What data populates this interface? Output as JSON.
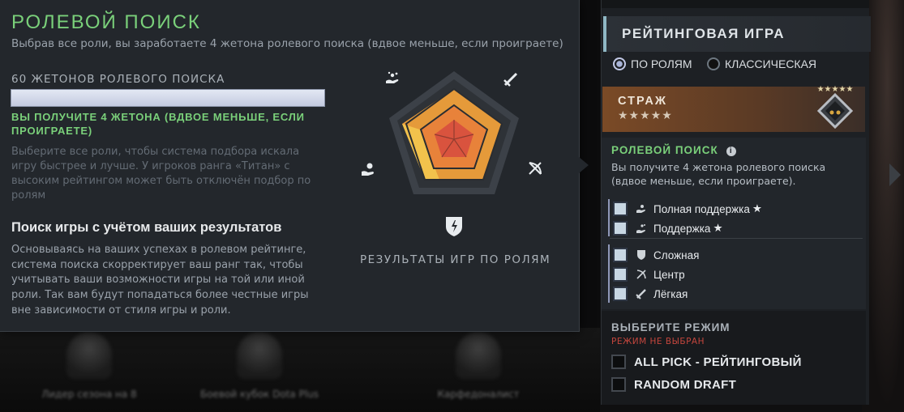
{
  "tooltip": {
    "title": "РОЛЕВОЙ ПОИСК",
    "subtitle": "Выбрав все роли, вы заработаете 4 жетона ролевого поиска (вдвое меньше, если проиграете)",
    "tokens_label": "60 ЖЕТОНОВ РОЛЕВОГО ПОИСКА",
    "token_bar_fill": 1.0,
    "reward_line1": "ВЫ ПОЛУЧИТЕ 4 ЖЕТОНА (ВДВОЕ МЕНЬШЕ, ЕСЛИ",
    "reward_line2": "ПРОИГРАЕТЕ)",
    "hint_line1": "Выберите все роли, чтобы система подбора искала",
    "hint_line2": "игру быстрее и лучше. У игроков ранга «Титан» с",
    "hint_line3": "высоким рейтингом может быть отключён подбор по",
    "hint_line4": "ролям",
    "section_title": "Поиск игры с учётом ваших результатов",
    "section_line1": "Основываясь на ваших успехах в ролевом рейтинге,",
    "section_line2": "система поиска скорректирует ваш ранг так, чтобы",
    "section_line3": "учитывать ваши возможности игры на той или иной",
    "section_line4": "роли. Так вам будут попадаться более честные игры",
    "section_line5": "вне зависимости от стиля игры и роли.",
    "radar_caption": "РЕЗУЛЬТАТЫ ИГР ПО РОЛЯМ",
    "radar_icons": [
      "support-hands-icon",
      "sword-icon",
      "bow-icon",
      "offlane-shield-icon",
      "hard-support-hand-icon"
    ]
  },
  "panel": {
    "title": "РЕЙТИНГОВАЯ ИГРА",
    "radio_roles": "ПО РОЛЯМ",
    "radio_classic": "КЛАССИЧЕСКАЯ",
    "rank_name": "СТРАЖ",
    "rank_stars": "★★★★★",
    "medal_stars": "★★★★★",
    "role_title": "РОЛЕВОЙ ПОИСК",
    "role_desc_line1": "Вы получите 4 жетона ролевого поиска",
    "role_desc_line2": "(вдвое меньше, если проиграете).",
    "roles": [
      {
        "label": "Полная поддержка",
        "star": "★"
      },
      {
        "label": "Поддержка",
        "star": "★"
      },
      {
        "label": "Сложная",
        "star": ""
      },
      {
        "label": "Центр",
        "star": ""
      },
      {
        "label": "Лёгкая",
        "star": ""
      }
    ],
    "mode_title": "ВЫБЕРИТЕ РЕЖИМ",
    "mode_warning": "РЕЖИМ НЕ ВЫБРАН",
    "modes": [
      "ALL PICK - РЕЙТИНГОВЫЙ",
      "RANDOM DRAFT"
    ]
  },
  "colors": {
    "accent_green": "#7ad07a",
    "warning_red": "#c4463d",
    "panel_bg": "#23272c"
  },
  "background": {
    "blurred_labels": [
      "Лидер сезона на 8",
      "Боевой кубок Dota Plus",
      "Карфедоналист"
    ]
  }
}
